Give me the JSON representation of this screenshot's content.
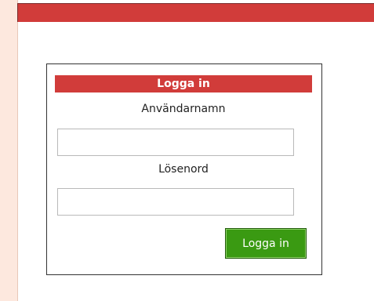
{
  "login": {
    "title": "Logga in",
    "username_label": "Användarnamn",
    "username_value": "",
    "password_label": "Lösenord",
    "password_value": "",
    "submit_label": "Logga in"
  },
  "colors": {
    "accent_red": "#d13c3a",
    "button_green": "#3a9a12",
    "page_margin": "#fde8de"
  }
}
